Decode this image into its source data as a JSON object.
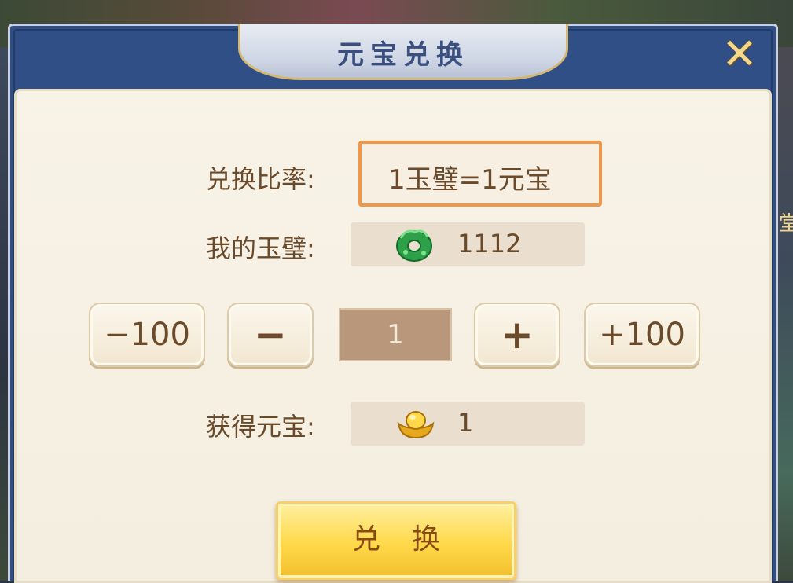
{
  "dialog": {
    "title": "元宝兑换",
    "close_label": "✕"
  },
  "rate": {
    "label": "兑换比率:",
    "value": "1玉璧=1元宝"
  },
  "my_jade": {
    "label": "我的玉璧:",
    "icon": "jade-disc-icon",
    "amount": "1112"
  },
  "stepper": {
    "minus_100_label": "−100",
    "minus_label": "−",
    "quantity": "1",
    "plus_label": "+",
    "plus_100_label": "+100"
  },
  "obtain": {
    "label": "获得元宝:",
    "icon": "gold-ingot-icon",
    "amount": "1"
  },
  "exchange_button": {
    "label": "兑换"
  },
  "background": {
    "edge_glyph": "堂"
  },
  "colors": {
    "frame_blue": "#2f4f86",
    "highlight_orange": "#f0974a",
    "button_gold": "#ffd94a",
    "text_brown": "#6a4a2a"
  }
}
